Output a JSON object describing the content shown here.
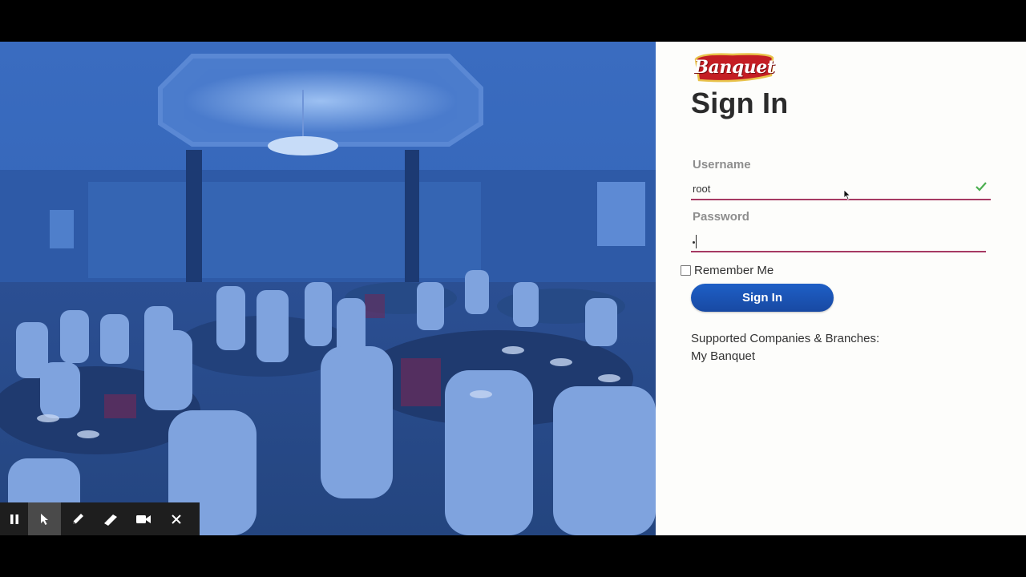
{
  "brand": {
    "logo_text": "Banquet",
    "accent": "#c41e24"
  },
  "form": {
    "title": "Sign In",
    "username_label": "Username",
    "username_value": "root",
    "password_label": "Password",
    "remember_label": "Remember Me",
    "remember_checked": false,
    "submit_label": "Sign In",
    "field_underline_color": "#a63a63",
    "button_color": "#1e5fc6",
    "valid_icon": "check-icon"
  },
  "supported": {
    "label": "Supported Companies & Branches:",
    "value": "My Banquet"
  },
  "recorder_toolbar": {
    "buttons": [
      "pause-icon",
      "pointer-icon",
      "pen-icon",
      "highlighter-icon",
      "camera-icon",
      "close-icon"
    ],
    "active": "pointer-icon"
  },
  "hero": {
    "description_icon": "banquet-hall-photo",
    "tint": "#2d5aa8"
  }
}
